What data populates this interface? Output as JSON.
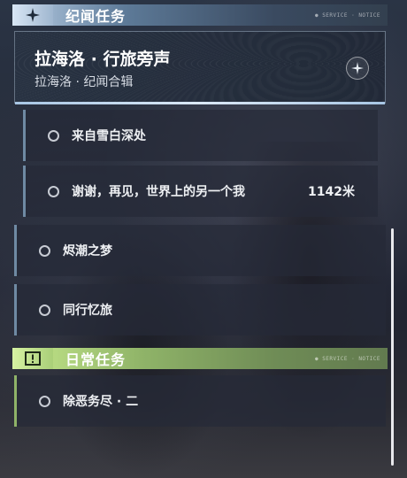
{
  "sections": {
    "lore": {
      "title": "纪闻任务",
      "tag": "● SERVICE · NOTICE",
      "icon": "sparkle-icon"
    },
    "daily": {
      "title": "日常任务",
      "tag": "● SERVICE · NOTICE",
      "icon": "exclamation-icon"
    }
  },
  "featured": {
    "title": "拉海洛 · 行旅旁声",
    "subtitle": "拉海洛 · 纪闻合辑",
    "badge_icon": "compass-star-icon"
  },
  "lore_subquests": [
    {
      "name": "来自雪白深处",
      "distance": ""
    },
    {
      "name": "谢谢，再见，世界上的另一个我",
      "distance": "1142米"
    }
  ],
  "lore_quests": [
    {
      "name": "烬潮之梦"
    },
    {
      "name": "同行忆旅"
    }
  ],
  "daily_quests": [
    {
      "name": "除恶务尽 · 二"
    }
  ],
  "colors": {
    "lore_accent": "#b9cfe6",
    "daily_accent": "#c7ea8c",
    "quest_border": "#6f8aa3",
    "daily_border": "#8fb368"
  }
}
